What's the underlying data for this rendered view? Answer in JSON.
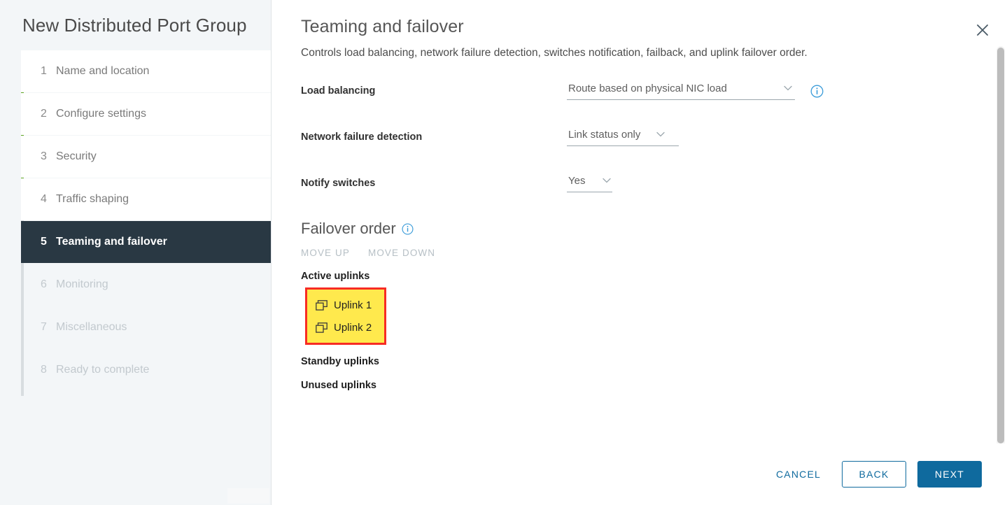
{
  "sidebar": {
    "title": "New Distributed Port Group",
    "steps": [
      {
        "num": "1",
        "label": "Name and location",
        "state": "completed"
      },
      {
        "num": "2",
        "label": "Configure settings",
        "state": "completed"
      },
      {
        "num": "3",
        "label": "Security",
        "state": "completed"
      },
      {
        "num": "4",
        "label": "Traffic shaping",
        "state": "completed"
      },
      {
        "num": "5",
        "label": "Teaming and failover",
        "state": "active"
      },
      {
        "num": "6",
        "label": "Monitoring",
        "state": "upcoming"
      },
      {
        "num": "7",
        "label": "Miscellaneous",
        "state": "upcoming"
      },
      {
        "num": "8",
        "label": "Ready to complete",
        "state": "upcoming"
      }
    ]
  },
  "main": {
    "title": "Teaming and failover",
    "subtitle": "Controls load balancing, network failure detection, switches notification, failback, and uplink failover order.",
    "close_icon": "close-icon",
    "fields": [
      {
        "label": "Load balancing",
        "value": "Route based on physical NIC load",
        "has_info": true,
        "icon": "info-icon"
      },
      {
        "label": "Network failure detection",
        "value": "Link status only",
        "has_info": false
      },
      {
        "label": "Notify switches",
        "value": "Yes",
        "has_info": false
      }
    ],
    "failover": {
      "title": "Failover order",
      "info_icon": "info-icon",
      "move_up_label": "Move up",
      "move_down_label": "Move down",
      "groups": [
        {
          "label": "Active uplinks",
          "highlighted": true,
          "items": [
            {
              "name": "Uplink 1",
              "icon": "nic-uplink-icon"
            },
            {
              "name": "Uplink 2",
              "icon": "nic-uplink-icon"
            }
          ]
        },
        {
          "label": "Standby uplinks",
          "highlighted": false,
          "items": []
        },
        {
          "label": "Unused uplinks",
          "highlighted": false,
          "items": []
        }
      ]
    }
  },
  "footer": {
    "cancel_label": "Cancel",
    "back_label": "Back",
    "next_label": "Next"
  },
  "colors": {
    "accent_blue": "#0f6a9e",
    "progress_green": "#5aa220",
    "active_step_bg": "#293843",
    "highlight_fill": "#ffe94d",
    "highlight_border": "#f72c24",
    "sidebar_bg": "#f3f6f8"
  }
}
